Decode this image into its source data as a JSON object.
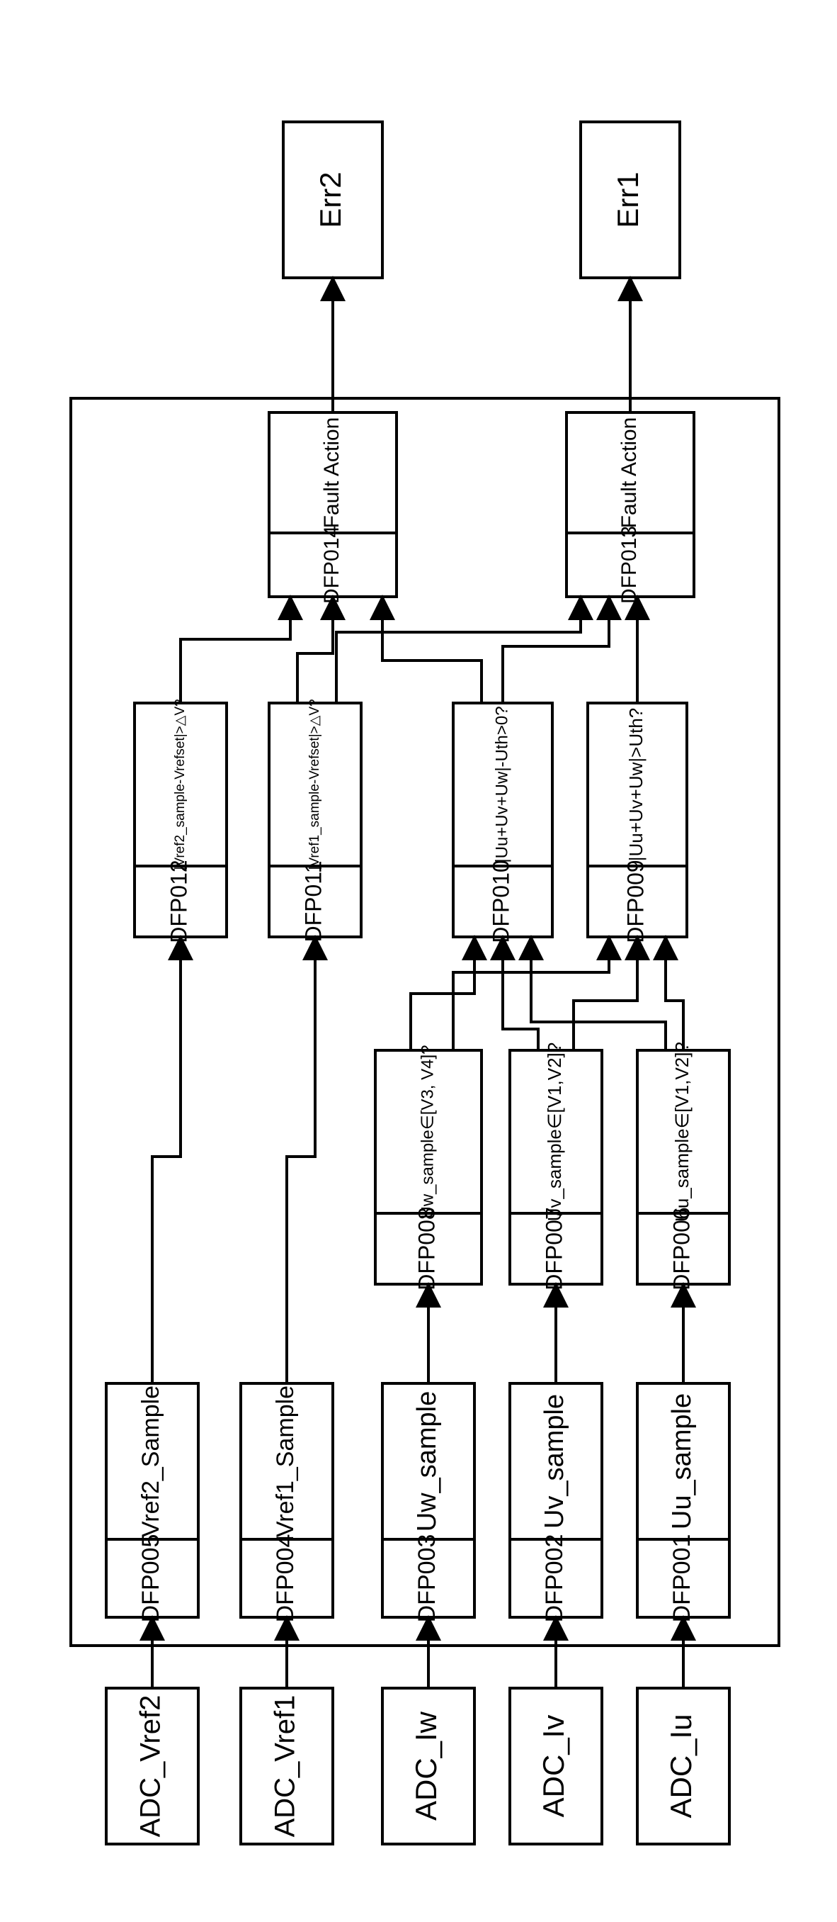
{
  "inputs": {
    "adc_iu": "ADC_Iu",
    "adc_iv": "ADC_Iv",
    "adc_iw": "ADC_Iw",
    "adc_vref1": "ADC_Vref1",
    "adc_vref2": "ADC_Vref2"
  },
  "outputs": {
    "err1": "Err1",
    "err2": "Err2"
  },
  "dfp001": {
    "id": "DFP001",
    "desc": "Uu_sample"
  },
  "dfp002": {
    "id": "DFP002",
    "desc": "Uv_sample"
  },
  "dfp003": {
    "id": "DFP003",
    "desc": "Uw_sample"
  },
  "dfp004": {
    "id": "DFP004",
    "desc": "Vref1_Sample"
  },
  "dfp005": {
    "id": "DFP005",
    "desc": "Vref2_Sample"
  },
  "dfp006": {
    "id": "DFP006",
    "desc": "Uu_sample∈[V1,V2]?"
  },
  "dfp007": {
    "id": "DFP007",
    "desc": "Uv_sample∈[V1,V2]?"
  },
  "dfp008": {
    "id": "DFP008",
    "desc": "Uw_sample∈[V3, V4]?"
  },
  "dfp009": {
    "id": "DFP009",
    "desc": "|Uu+Uv+Uw|>Uth?"
  },
  "dfp010": {
    "id": "DFP010",
    "desc": "|Uu+Uv+Uw|-Uth>0?"
  },
  "dfp011": {
    "id": "DFP011",
    "desc": "|Vref1_sample-Vrefset|>△V?"
  },
  "dfp012": {
    "id": "DFP012",
    "desc": "|Vref2_sample-Vrefset|>△V?"
  },
  "dfp013": {
    "id": "DFP013",
    "desc": "Fault Action"
  },
  "dfp014": {
    "id": "DFP014",
    "desc": "Fault Action"
  }
}
